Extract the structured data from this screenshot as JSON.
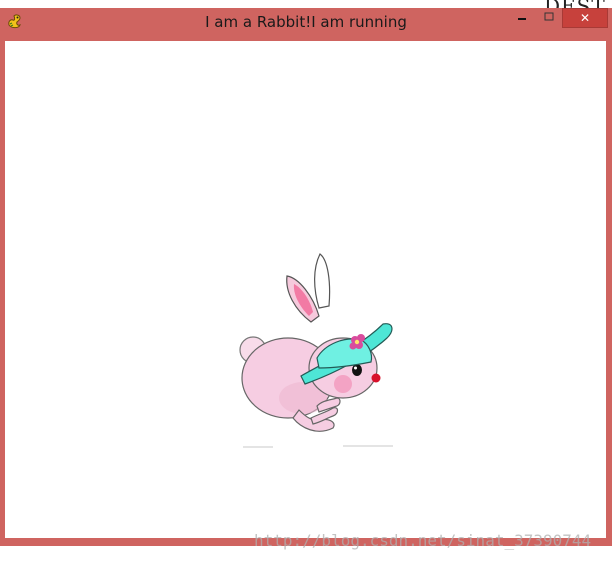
{
  "background_text": "DEST",
  "window": {
    "title": "I am a Rabbit!I am running",
    "icon": "pygame-snake-icon",
    "controls": {
      "minimize": "minimize-icon",
      "maximize": "maximize-icon",
      "close_label": "✕"
    }
  },
  "content": {
    "sprite": "rabbit-running-sprite"
  },
  "watermark": "http://blog.csdn.net/sinat_37390744",
  "colors": {
    "frame": "#cf6460",
    "close_button": "#c7413c",
    "client_background": "#ffffff"
  }
}
